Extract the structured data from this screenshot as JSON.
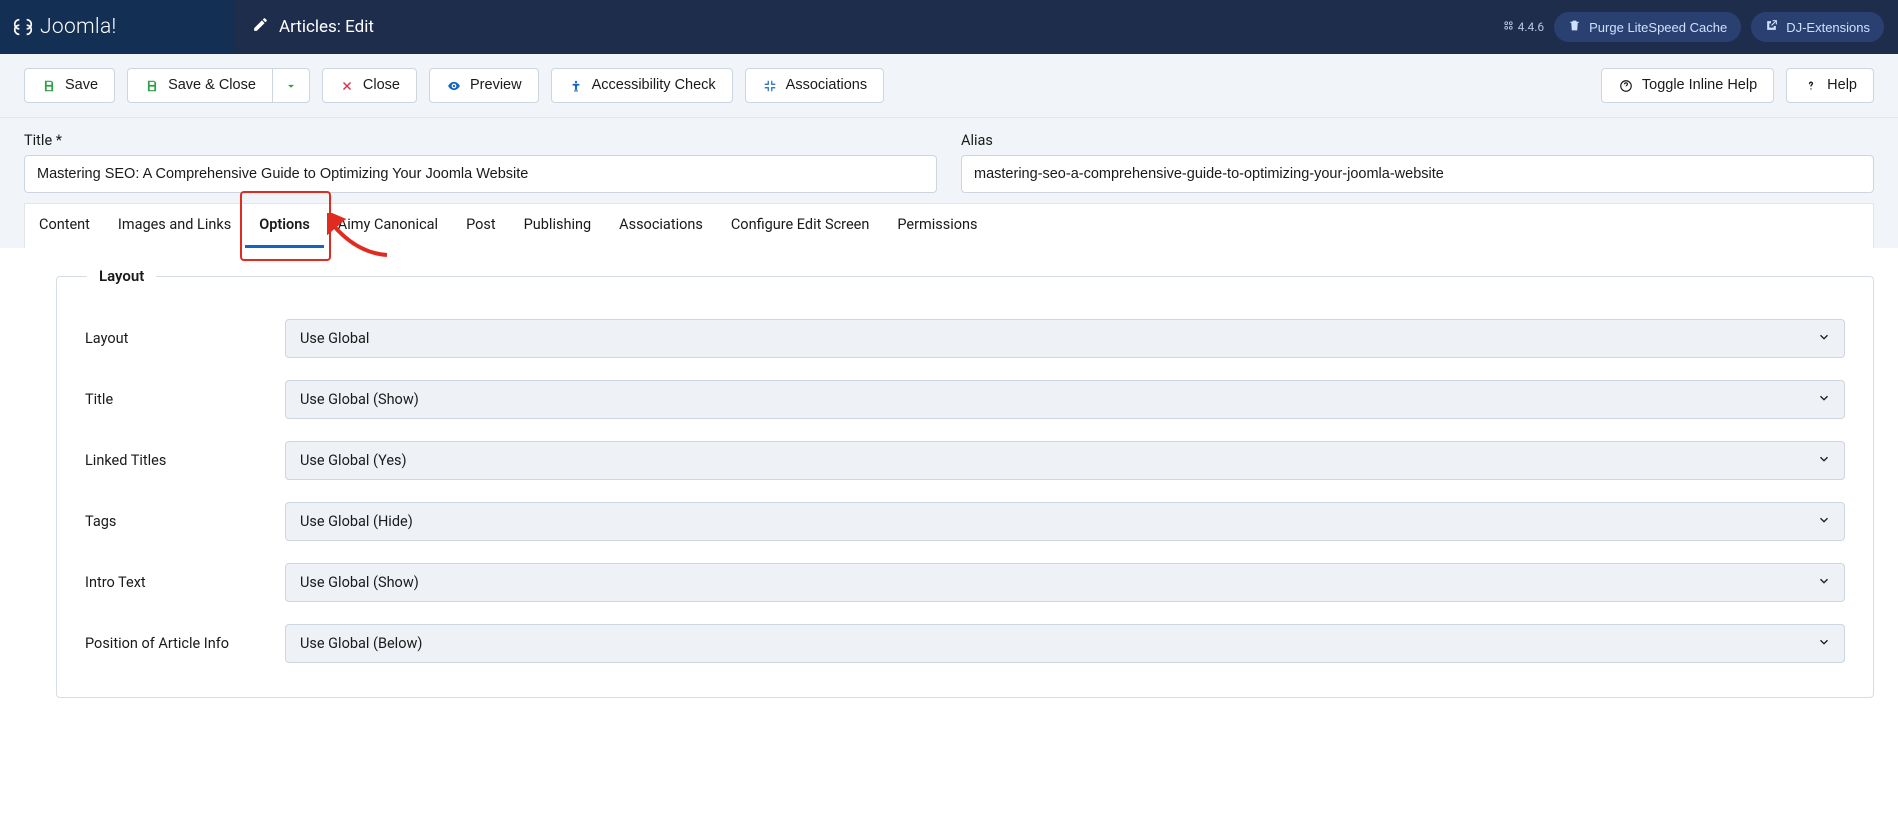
{
  "brand": "Joomla!",
  "page_title": "Articles: Edit",
  "version": "4.4.6",
  "header_buttons": {
    "purge": "Purge LiteSpeed Cache",
    "dj": "DJ-Extensions"
  },
  "toolbar": {
    "save": "Save",
    "save_close": "Save & Close",
    "close": "Close",
    "preview": "Preview",
    "accessibility": "Accessibility Check",
    "associations": "Associations",
    "toggle_inline_help": "Toggle Inline Help",
    "help": "Help"
  },
  "title_field": {
    "label": "Title *",
    "value": "Mastering SEO: A Comprehensive Guide to Optimizing Your Joomla Website"
  },
  "alias_field": {
    "label": "Alias",
    "value": "mastering-seo-a-comprehensive-guide-to-optimizing-your-joomla-website"
  },
  "tabs": [
    {
      "label": "Content",
      "id": "content"
    },
    {
      "label": "Images and Links",
      "id": "images-links"
    },
    {
      "label": "Options",
      "id": "options",
      "active": true
    },
    {
      "label": "Aimy Canonical",
      "id": "aimy-canonical"
    },
    {
      "label": "Post",
      "id": "post"
    },
    {
      "label": "Publishing",
      "id": "publishing"
    },
    {
      "label": "Associations",
      "id": "associations"
    },
    {
      "label": "Configure Edit Screen",
      "id": "configure-edit"
    },
    {
      "label": "Permissions",
      "id": "permissions"
    }
  ],
  "layout_fieldset": {
    "legend": "Layout",
    "rows": [
      {
        "label": "Layout",
        "value": "Use Global"
      },
      {
        "label": "Title",
        "value": "Use Global (Show)"
      },
      {
        "label": "Linked Titles",
        "value": "Use Global (Yes)"
      },
      {
        "label": "Tags",
        "value": "Use Global (Hide)"
      },
      {
        "label": "Intro Text",
        "value": "Use Global (Show)"
      },
      {
        "label": "Position of Article Info",
        "value": "Use Global (Below)"
      }
    ]
  },
  "annotation": {
    "highlight_tab": "options"
  }
}
